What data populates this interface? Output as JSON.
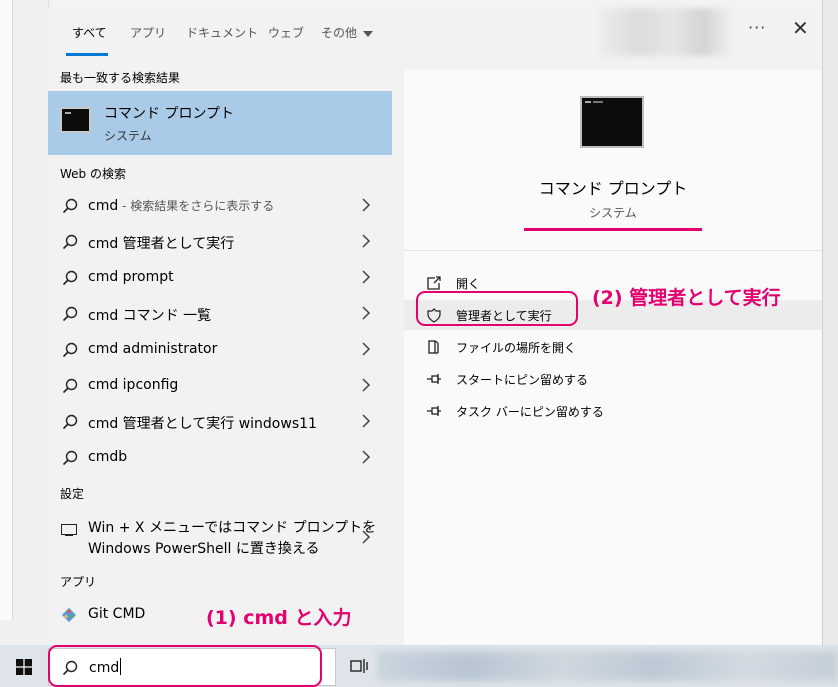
{
  "tabs": [
    {
      "label": "すべて"
    },
    {
      "label": "アプリ"
    },
    {
      "label": "ドキュメント"
    },
    {
      "label": "ウェブ"
    },
    {
      "label": "その他"
    }
  ],
  "titlebar": {
    "more": "···",
    "close": "✕"
  },
  "best_match": {
    "header": "最も一致する検索結果",
    "title": "コマンド プロンプト",
    "subtitle": "システム"
  },
  "web": {
    "header": "Web の検索",
    "results": [
      {
        "text": "cmd",
        "suffix": " - 検索結果をさらに表示する"
      },
      {
        "text": "cmd 管理者として実行",
        "suffix": ""
      },
      {
        "text": "cmd prompt",
        "suffix": ""
      },
      {
        "text": "cmd コマンド 一覧",
        "suffix": ""
      },
      {
        "text": "cmd administrator",
        "suffix": ""
      },
      {
        "text": "cmd ipconfig",
        "suffix": ""
      },
      {
        "text": "cmd 管理者として実行 windows11",
        "suffix": ""
      },
      {
        "text": "cmdb",
        "suffix": ""
      }
    ]
  },
  "settings": {
    "header": "設定",
    "line1": "Win + X メニューではコマンド プロンプトを",
    "line2": "Windows PowerShell に置き換える"
  },
  "apps": {
    "header": "アプリ",
    "item": "Git CMD"
  },
  "preview": {
    "title": "コマンド プロンプト",
    "subtitle": "システム",
    "actions": [
      {
        "label": "開く",
        "icon": "open-icon"
      },
      {
        "label": "管理者として実行",
        "icon": "shield-icon"
      },
      {
        "label": "ファイルの場所を開く",
        "icon": "file-location-icon"
      },
      {
        "label": "スタートにピン留めする",
        "icon": "pin-icon"
      },
      {
        "label": "タスク バーにピン留めする",
        "icon": "pin-icon"
      }
    ]
  },
  "annotations": {
    "step1": "(1) cmd と入力",
    "step2": "(2) 管理者として実行"
  },
  "taskbar": {
    "search_value": "cmd"
  },
  "colors": {
    "accent": "#0078d4",
    "highlight": "#aacbe7",
    "annotation": "#e3006f"
  }
}
